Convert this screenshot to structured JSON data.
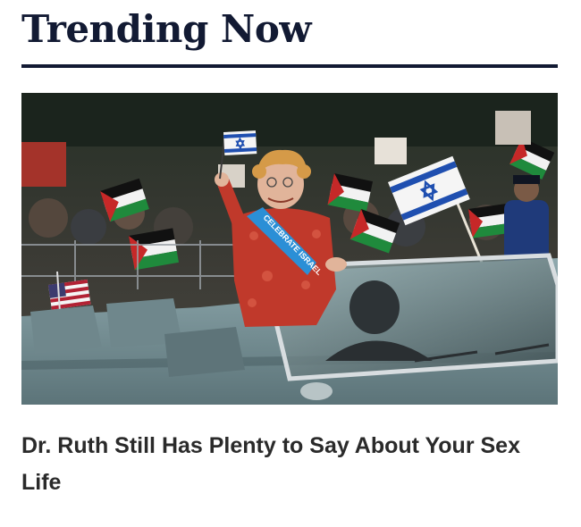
{
  "section": {
    "title": "Trending Now"
  },
  "article": {
    "headline": "Dr. Ruth Still Has Plenty to Say About Your Sex Life",
    "sash_text": "CELEBRATE ISRAEL"
  },
  "colors": {
    "heading": "#121a33",
    "rule": "#121a33",
    "headline": "#2a2a2a",
    "car": "#7f9aa0",
    "dress": "#c0392b",
    "sash": "#2b8fd6"
  }
}
